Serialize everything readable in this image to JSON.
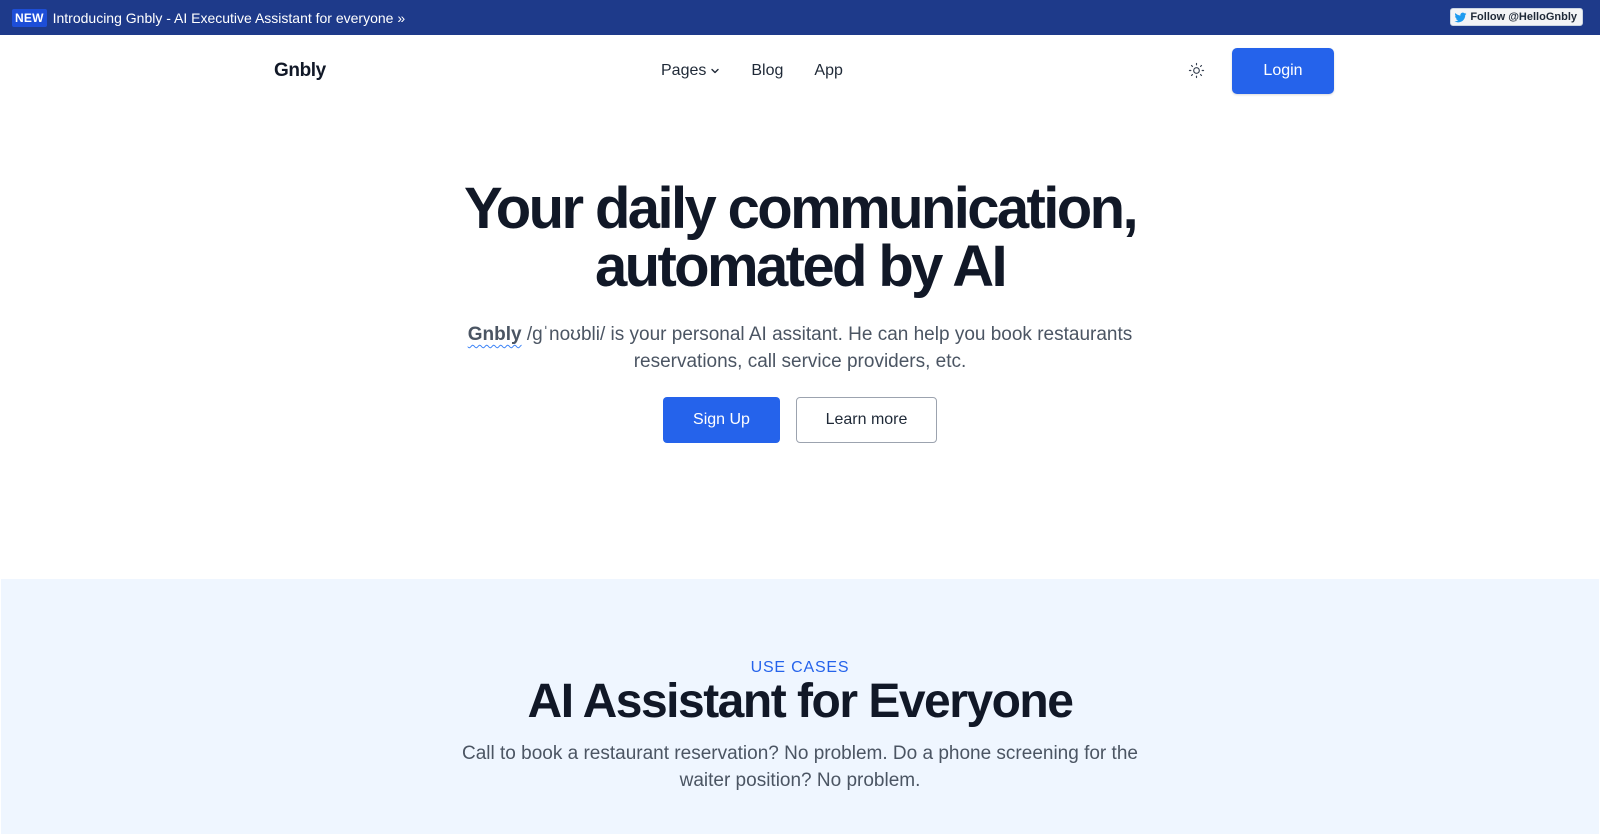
{
  "announcement": {
    "badge": "NEW",
    "text": "Introducing Gnbly - AI Executive Assistant for everyone »",
    "follow_label": "Follow @HelloGnbly",
    "bar_color": "#1e3a8a"
  },
  "nav": {
    "brand": "Gnbly",
    "links": [
      {
        "label": "Pages",
        "has_dropdown": true
      },
      {
        "label": "Blog"
      },
      {
        "label": "App"
      }
    ],
    "theme_icon": "sun-icon",
    "login_label": "Login"
  },
  "hero": {
    "title_line1": "Your daily communication,",
    "title_line2": "automated by AI",
    "subtitle_brand": "Gnbly",
    "subtitle_rest": " /gˈnoʊbli/ is your personal AI assitant. He can help you book restaurants reservations, call service providers, etc.",
    "primary_cta": "Sign Up",
    "secondary_cta": "Learn more"
  },
  "use_cases": {
    "eyebrow": "USE CASES",
    "title": "AI Assistant for Everyone",
    "subtitle": "Call to book a restaurant reservation? No problem. Do a phone screening for the waiter position? No problem.",
    "background": "#eff6ff"
  },
  "colors": {
    "accent": "#2563eb",
    "text_dark": "#111827",
    "text_muted": "#4b5563"
  }
}
